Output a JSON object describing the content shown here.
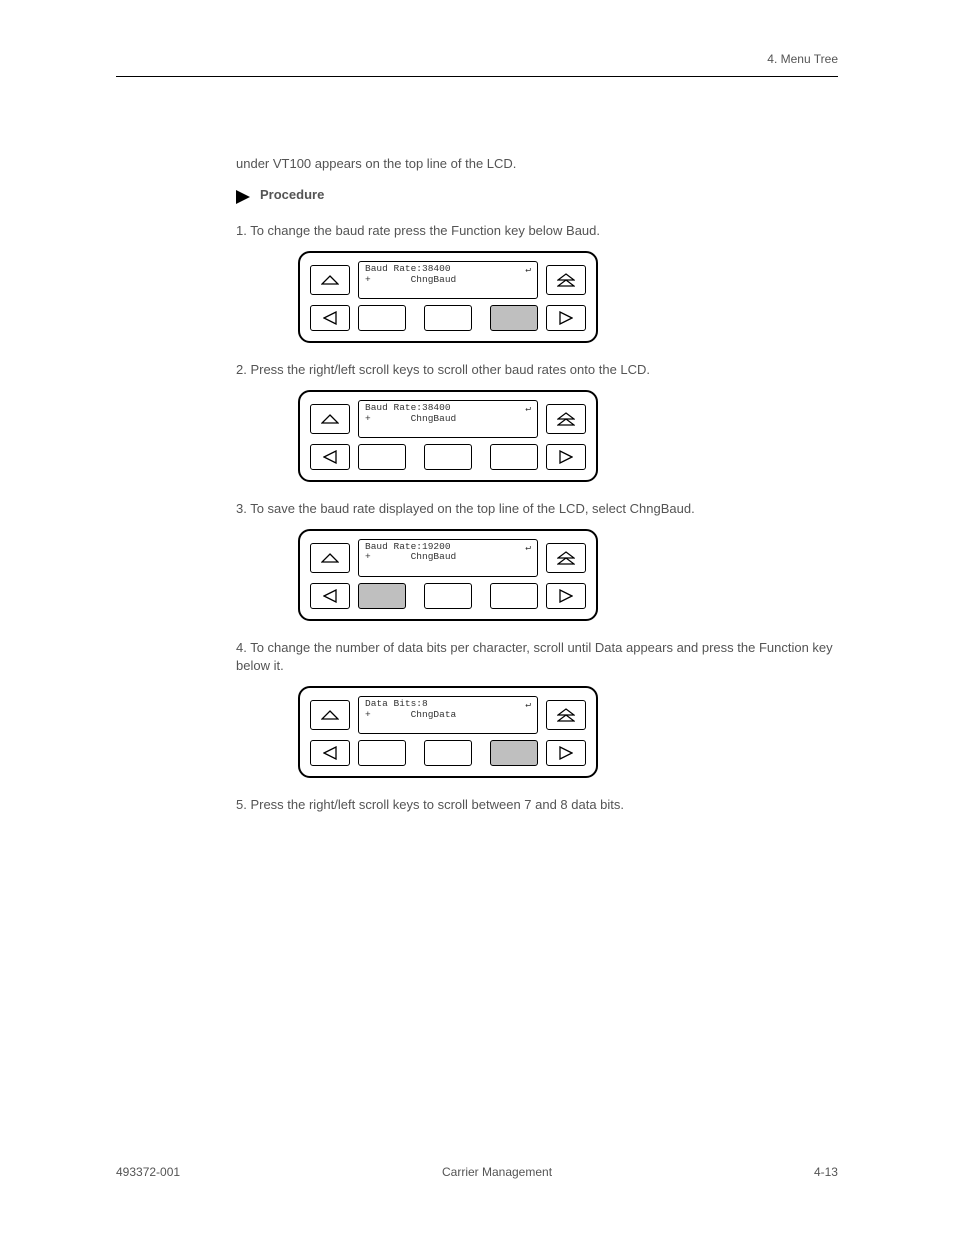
{
  "header": {
    "title": "4. Menu Tree"
  },
  "intro": "under VT100 appears on the top line of the LCD.",
  "bullet": "Procedure",
  "steps": [
    {
      "text": "1.  To change the baud rate press the Function key below Baud.",
      "panel": {
        "lcd": {
          "line1": "Baud Rate:38400",
          "line2": "+       ChngBaud"
        },
        "highlight_soft": 2
      }
    },
    {
      "text": "2.  Press the right/left scroll keys to scroll other baud rates onto the LCD.",
      "panel": {
        "lcd": {
          "line1": "Baud Rate:38400",
          "line2": "+       ChngBaud"
        },
        "highlight_soft": -1
      }
    },
    {
      "text": "3.  To save the baud rate displayed on the top line of the LCD, select ChngBaud.",
      "panel": {
        "lcd": {
          "line1": "Baud Rate:19200",
          "line2": "+       ChngBaud"
        },
        "highlight_soft": 0
      }
    },
    {
      "text": "4.  To change the number of data bits per character, scroll until Data appears and press the Function key below it.",
      "panel": {
        "lcd": {
          "line1": "Data Bits:8",
          "line2": "+       ChngData"
        },
        "highlight_soft": 2
      }
    },
    {
      "text": "5.  Press the right/left scroll keys to scroll between 7 and 8 data bits."
    }
  ],
  "footer": {
    "left": "493372-001",
    "center": "Carrier Management",
    "right": "4-13"
  },
  "icons": {
    "corner_glyph": "↵"
  }
}
